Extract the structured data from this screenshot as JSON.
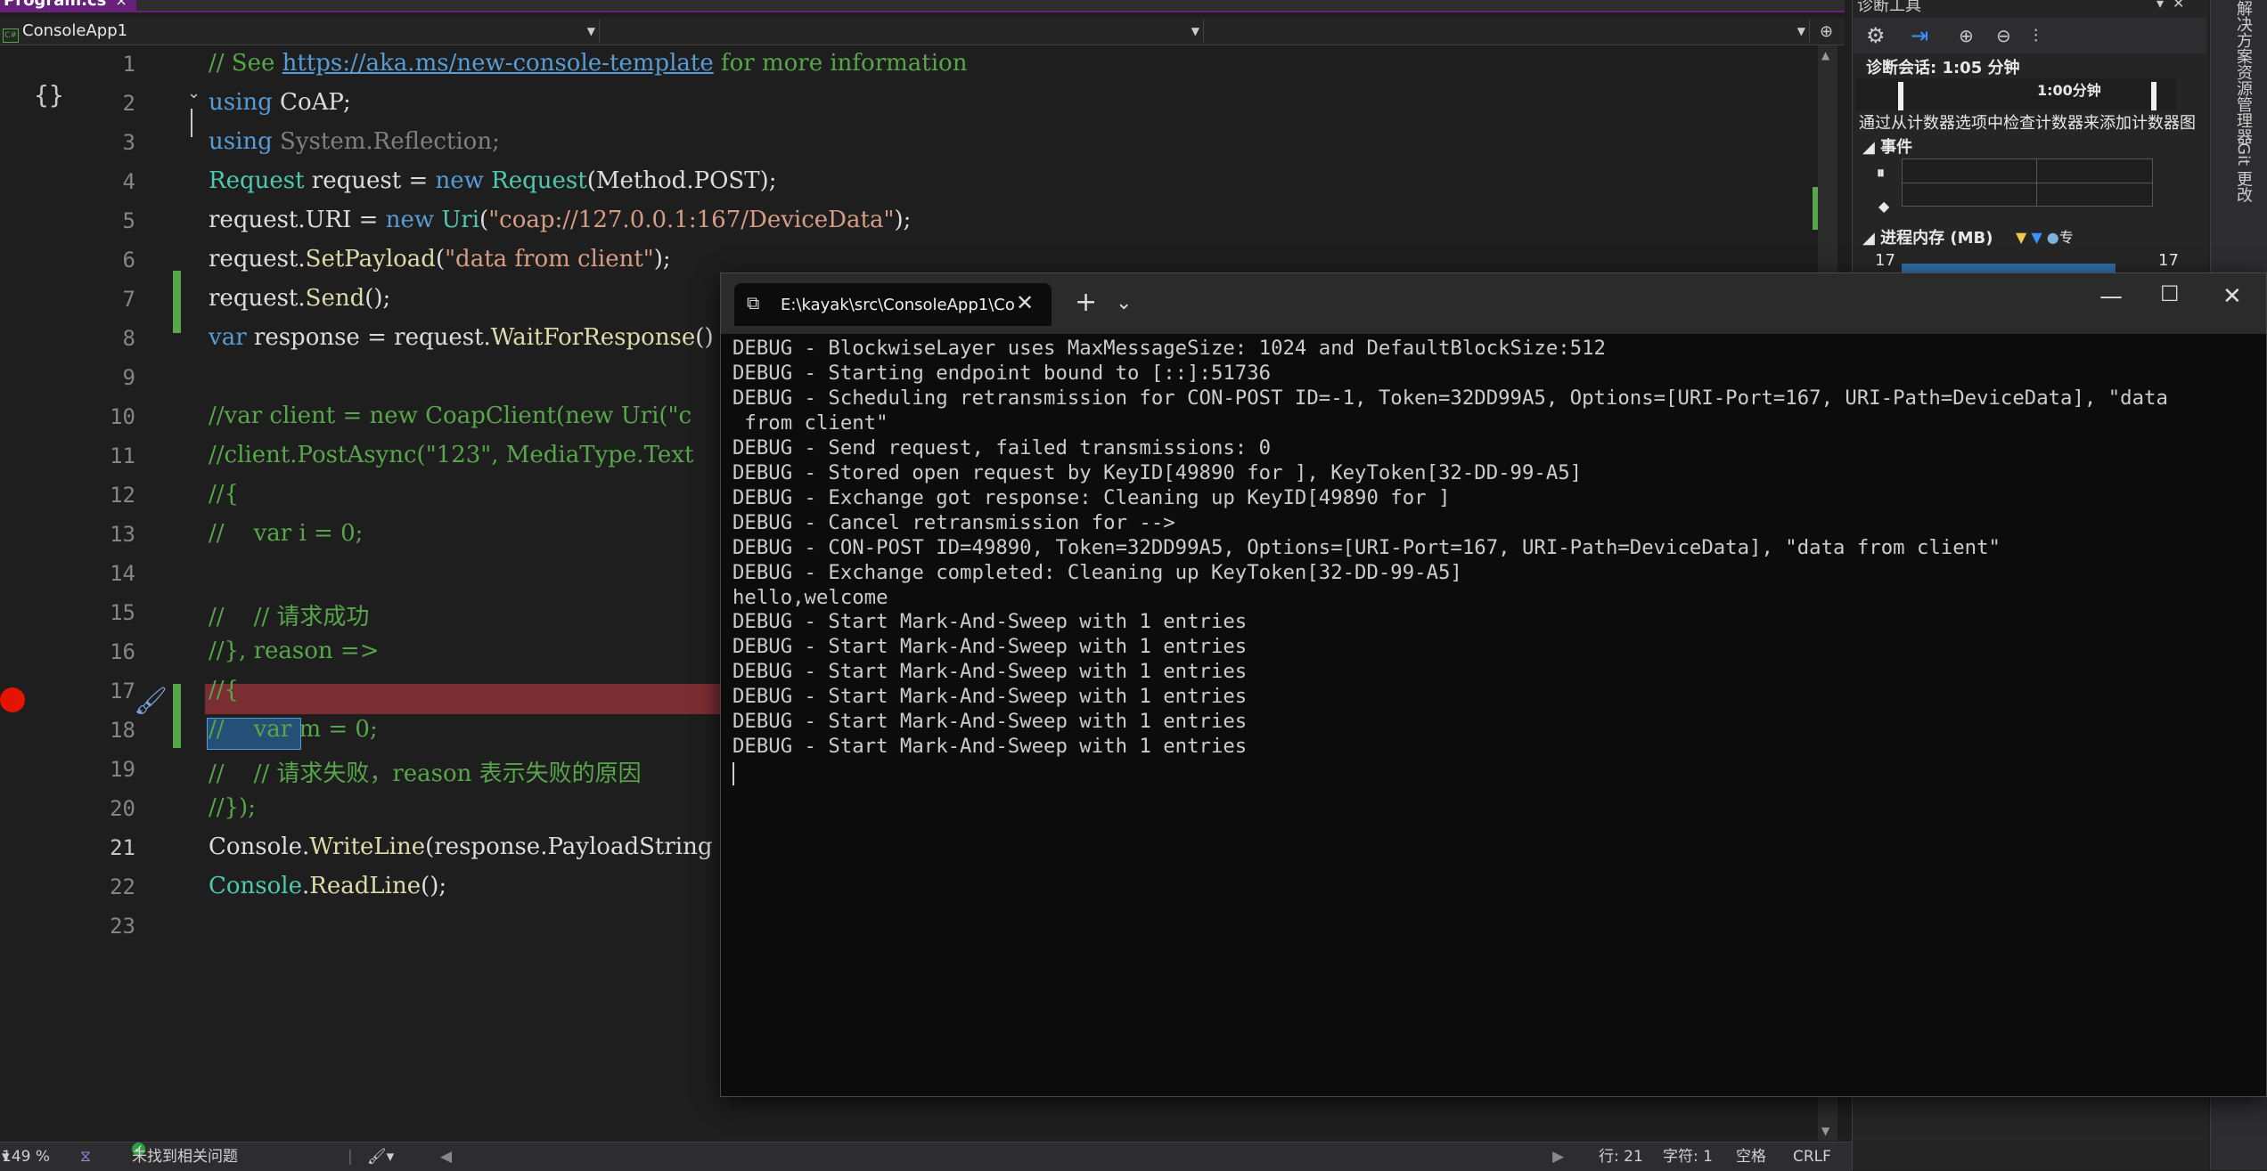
{
  "tab": {
    "title": "Program.cs",
    "close": "×"
  },
  "nav": {
    "project": "ConsoleApp1",
    "project_icon": "C#"
  },
  "code_lines": [
    {
      "n": "1",
      "segs": [
        {
          "t": "// See ",
          "c": "cmt"
        },
        {
          "t": "https://aka.ms/new-console-template",
          "c": "lnk"
        },
        {
          "t": " for more information",
          "c": "cmt"
        }
      ]
    },
    {
      "n": "2",
      "segs": [
        {
          "t": "using",
          "c": "kw"
        },
        {
          "t": " CoAP;",
          "c": ""
        }
      ]
    },
    {
      "n": "3",
      "segs": [
        {
          "t": "using",
          "c": "kw"
        },
        {
          "t": " System.Reflection;",
          "c": "dim"
        }
      ]
    },
    {
      "n": "4",
      "segs": [
        {
          "t": "Request",
          "c": "ty"
        },
        {
          "t": " request = ",
          "c": ""
        },
        {
          "t": "new",
          "c": "kw"
        },
        {
          "t": " ",
          "c": ""
        },
        {
          "t": "Request",
          "c": "ty"
        },
        {
          "t": "(Method.POST);",
          "c": ""
        }
      ]
    },
    {
      "n": "5",
      "segs": [
        {
          "t": "request.URI = ",
          "c": ""
        },
        {
          "t": "new",
          "c": "kw"
        },
        {
          "t": " ",
          "c": ""
        },
        {
          "t": "Uri",
          "c": "ty"
        },
        {
          "t": "(",
          "c": ""
        },
        {
          "t": "\"coap://127.0.0.1:167/DeviceData\"",
          "c": "str"
        },
        {
          "t": ");",
          "c": ""
        }
      ]
    },
    {
      "n": "6",
      "segs": [
        {
          "t": "request.",
          "c": ""
        },
        {
          "t": "SetPayload",
          "c": "mt"
        },
        {
          "t": "(",
          "c": ""
        },
        {
          "t": "\"data from client\"",
          "c": "str"
        },
        {
          "t": ");",
          "c": ""
        }
      ]
    },
    {
      "n": "7",
      "segs": [
        {
          "t": "request.",
          "c": ""
        },
        {
          "t": "Send",
          "c": "mt"
        },
        {
          "t": "();",
          "c": ""
        }
      ]
    },
    {
      "n": "8",
      "segs": [
        {
          "t": "var",
          "c": "kw"
        },
        {
          "t": " response = request.",
          "c": ""
        },
        {
          "t": "WaitForResponse",
          "c": "mt"
        },
        {
          "t": "()",
          "c": ""
        }
      ]
    },
    {
      "n": "9",
      "segs": []
    },
    {
      "n": "10",
      "segs": [
        {
          "t": "//var client = new CoapClient(new Uri(\"c",
          "c": "cmt"
        }
      ]
    },
    {
      "n": "11",
      "segs": [
        {
          "t": "//client.PostAsync(\"123\", MediaType.Text",
          "c": "cmt"
        }
      ]
    },
    {
      "n": "12",
      "segs": [
        {
          "t": "//{",
          "c": "cmt"
        }
      ]
    },
    {
      "n": "13",
      "segs": [
        {
          "t": "//    var i = 0;",
          "c": "cmt"
        }
      ]
    },
    {
      "n": "14",
      "segs": []
    },
    {
      "n": "15",
      "segs": [
        {
          "t": "//    // 请求成功",
          "c": "cmt"
        }
      ]
    },
    {
      "n": "16",
      "segs": [
        {
          "t": "//}, reason =>",
          "c": "cmt"
        }
      ]
    },
    {
      "n": "17",
      "segs": [
        {
          "t": "//{",
          "c": "cmt"
        }
      ]
    },
    {
      "n": "18",
      "segs": [
        {
          "t": "//    var m = 0;",
          "c": "cmt"
        }
      ]
    },
    {
      "n": "19",
      "segs": [
        {
          "t": "//    // 请求失败，reason 表示失败的原因",
          "c": "cmt"
        }
      ]
    },
    {
      "n": "20",
      "segs": [
        {
          "t": "//});",
          "c": "cmt"
        }
      ]
    },
    {
      "n": "21",
      "segs": [
        {
          "t": "Console.",
          "c": ""
        },
        {
          "t": "WriteLine",
          "c": "mt"
        },
        {
          "t": "(response.PayloadString",
          "c": ""
        }
      ]
    },
    {
      "n": "22",
      "segs": [
        {
          "t": "Console",
          "c": "ty"
        },
        {
          "t": ".",
          "c": ""
        },
        {
          "t": "ReadLine",
          "c": "mt"
        },
        {
          "t": "();",
          "c": ""
        }
      ]
    },
    {
      "n": "23",
      "segs": []
    }
  ],
  "diagnostics": {
    "title": "诊断工具",
    "session": "诊断会话: 1:05 分钟",
    "timeline_label": "1:00分钟",
    "hint": "通过从计数器选项中检查计数器来添加计数器图",
    "events_header": "事件",
    "memory_header": "进程内存 (MB)",
    "memory_legend_extra": "专",
    "memory_left": "17",
    "memory_right": "17"
  },
  "side_tabs": [
    "解决方案资源管理器",
    "Git 更改"
  ],
  "status": {
    "zoom": "149 %",
    "issues": "未找到相关问题",
    "line": "行: 21",
    "char": "字符: 1",
    "spaces": "空格",
    "eol": "CRLF"
  },
  "terminal": {
    "tab_title": "E:\\kayak\\src\\ConsoleApp1\\Co",
    "lines": [
      "DEBUG - BlockwiseLayer uses MaxMessageSize: 1024 and DefaultBlockSize:512",
      "DEBUG - Starting endpoint bound to [::]:51736",
      "DEBUG - Scheduling retransmission for CON-POST ID=-1, Token=32DD99A5, Options=[URI-Port=167, URI-Path=DeviceData], \"data",
      " from client\"",
      "DEBUG - Send request, failed transmissions: 0",
      "DEBUG - Stored open request by KeyID[49890 for ], KeyToken[32-DD-99-A5]",
      "DEBUG - Exchange got response: Cleaning up KeyID[49890 for ]",
      "DEBUG - Cancel retransmission for -->",
      "DEBUG - CON-POST ID=49890, Token=32DD99A5, Options=[URI-Port=167, URI-Path=DeviceData], \"data from client\"",
      "DEBUG - Exchange completed: Cleaning up KeyToken[32-DD-99-A5]",
      "hello,welcome",
      "DEBUG - Start Mark-And-Sweep with 1 entries",
      "DEBUG - Start Mark-And-Sweep with 1 entries",
      "DEBUG - Start Mark-And-Sweep with 1 entries",
      "DEBUG - Start Mark-And-Sweep with 1 entries",
      "DEBUG - Start Mark-And-Sweep with 1 entries",
      "DEBUG - Start Mark-And-Sweep with 1 entries"
    ]
  }
}
